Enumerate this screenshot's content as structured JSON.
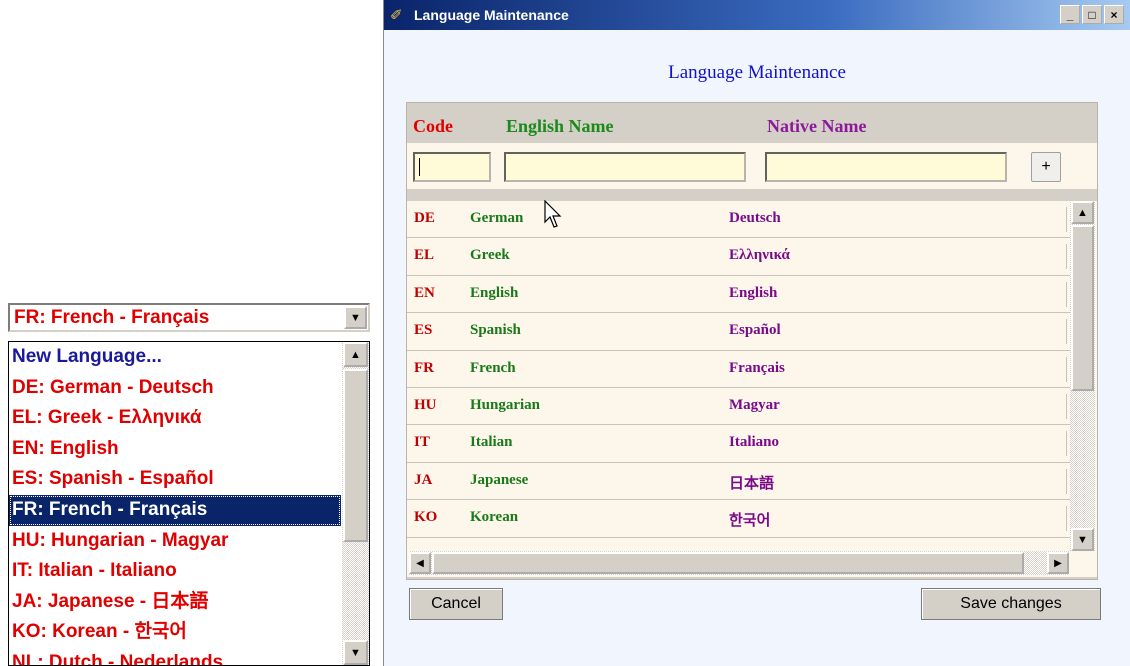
{
  "combo": {
    "selected": "FR: French - Français",
    "items": [
      "New Language...",
      "DE: German - Deutsch",
      "EL: Greek - Ελληνικά",
      "EN: English",
      "ES: Spanish - Español",
      "FR: French - Français",
      "HU: Hungarian - Magyar",
      "IT: Italian - Italiano",
      "JA: Japanese - 日本語",
      "KO: Korean - 한국어",
      "NL: Dutch - Nederlands"
    ]
  },
  "window": {
    "title": "Language Maintenance",
    "controls": {
      "minimize": "_",
      "maximize": "□",
      "close": "×"
    }
  },
  "dialog": {
    "heading": "Language Maintenance",
    "headers": {
      "code": "Code",
      "english": "English Name",
      "native": "Native Name"
    },
    "add_label": "+",
    "rows": [
      {
        "code": "DE",
        "english": "German",
        "native": "Deutsch"
      },
      {
        "code": "EL",
        "english": "Greek",
        "native": "Ελληνικά"
      },
      {
        "code": "EN",
        "english": "English",
        "native": "English"
      },
      {
        "code": "ES",
        "english": "Spanish",
        "native": "Español"
      },
      {
        "code": "FR",
        "english": "French",
        "native": "Français"
      },
      {
        "code": "HU",
        "english": "Hungarian",
        "native": "Magyar"
      },
      {
        "code": "IT",
        "english": "Italian",
        "native": "Italiano"
      },
      {
        "code": "JA",
        "english": "Japanese",
        "native": "日本語"
      },
      {
        "code": "KO",
        "english": "Korean",
        "native": "한국어"
      }
    ],
    "cancel_label": "Cancel",
    "save_label": "Save changes"
  },
  "colors": {
    "code": "#c00000",
    "english": "#1a7a1a",
    "native": "#7a0a8a",
    "heading": "#1212c8",
    "selection": "#0a246a"
  }
}
